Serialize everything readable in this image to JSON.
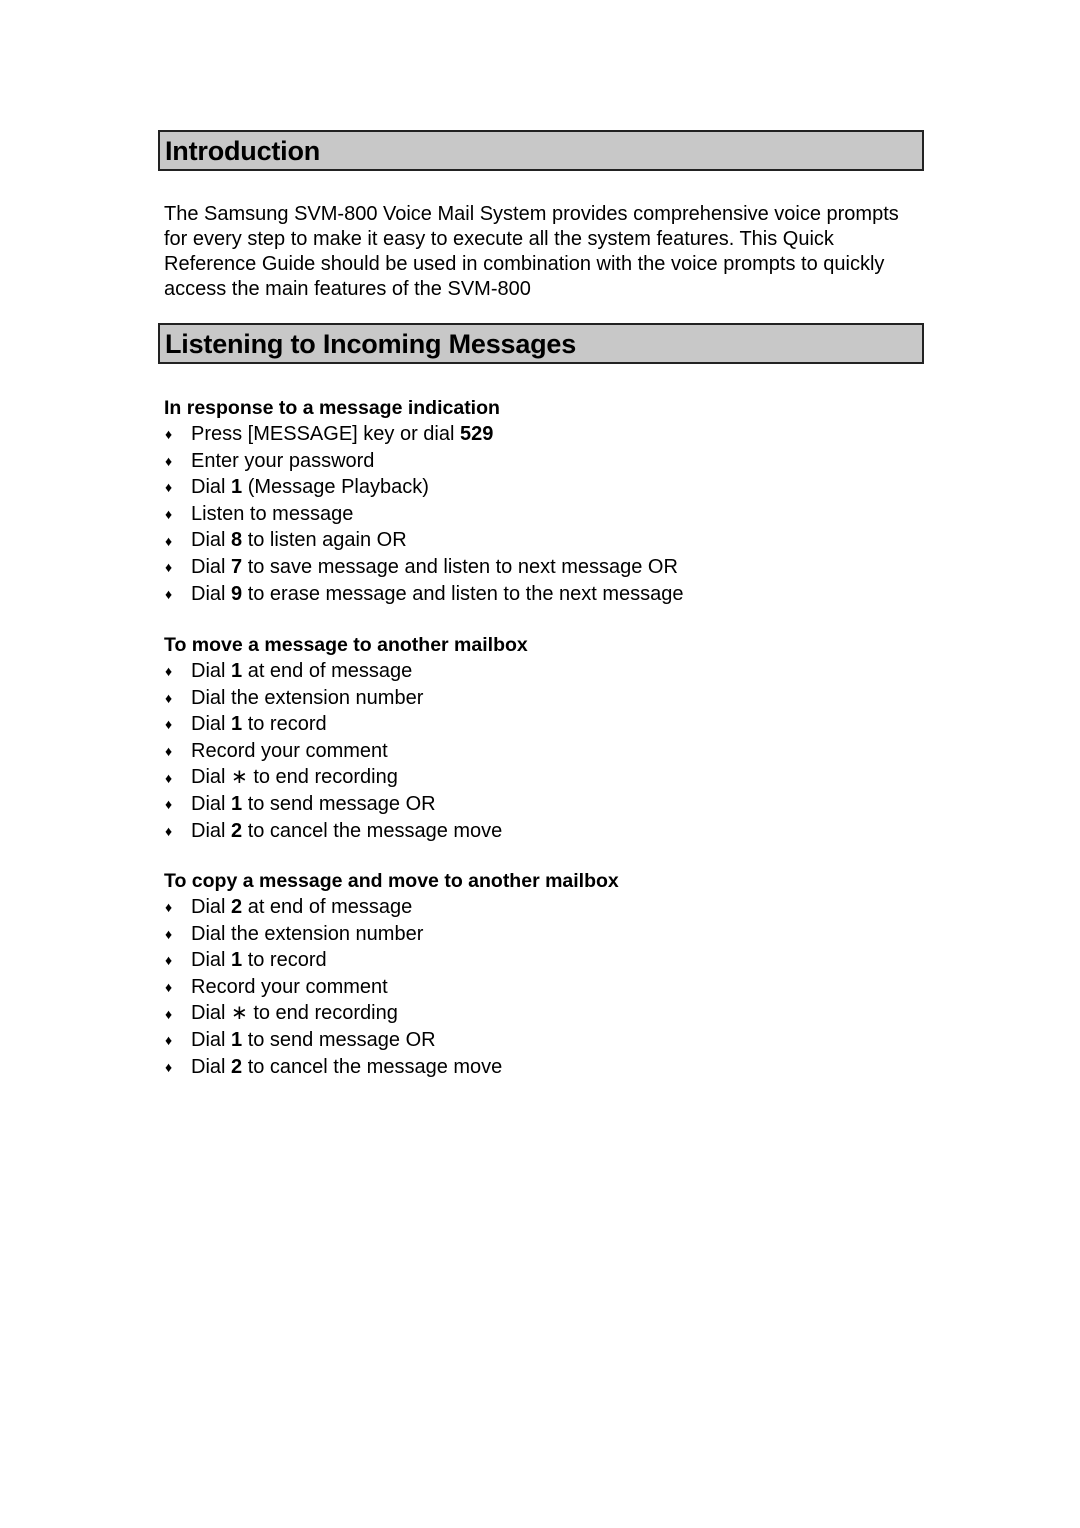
{
  "sections": {
    "introduction": {
      "title": "Introduction",
      "body": "The Samsung SVM-800 Voice Mail System provides comprehensive voice prompts for every step to make it easy to execute all the system features. This Quick Reference Guide should be used in combination with the voice prompts to quickly access the main features of the SVM-800"
    },
    "listening": {
      "title": "Listening to Incoming Messages",
      "blocks": [
        {
          "heading": "In response to a message indication",
          "items": [
            {
              "pre": "Press [MESSAGE] key or dial ",
              "key": "529",
              "post": ""
            },
            {
              "pre": "Enter your password",
              "key": "",
              "post": ""
            },
            {
              "pre": "Dial ",
              "key": "1",
              "post": " (Message Playback)"
            },
            {
              "pre": "Listen to message",
              "key": "",
              "post": ""
            },
            {
              "pre": "Dial ",
              "key": "8",
              "post": " to listen again OR"
            },
            {
              "pre": "Dial ",
              "key": "7",
              "post": " to save message and listen to next message OR"
            },
            {
              "pre": "Dial ",
              "key": "9",
              "post": " to erase message and listen to the next message"
            }
          ]
        },
        {
          "heading": "To move a message to another mailbox",
          "items": [
            {
              "pre": "Dial ",
              "key": "1",
              "post": " at end of message"
            },
            {
              "pre": "Dial the extension number",
              "key": "",
              "post": ""
            },
            {
              "pre": "Dial ",
              "key": "1",
              "post": " to record"
            },
            {
              "pre": "Record your comment",
              "key": "",
              "post": ""
            },
            {
              "pre": "Dial ∗ to end recording",
              "key": "",
              "post": ""
            },
            {
              "pre": "Dial ",
              "key": "1",
              "post": " to send message OR"
            },
            {
              "pre": "Dial ",
              "key": "2",
              "post": " to cancel the message move"
            }
          ]
        },
        {
          "heading": "To copy a message and move to another mailbox",
          "items": [
            {
              "pre": "Dial ",
              "key": "2",
              "post": " at end of message"
            },
            {
              "pre": "Dial the extension number",
              "key": "",
              "post": ""
            },
            {
              "pre": "Dial ",
              "key": "1",
              "post": " to record"
            },
            {
              "pre": "Record your comment",
              "key": "",
              "post": ""
            },
            {
              "pre": "Dial ∗ to end recording",
              "key": "",
              "post": ""
            },
            {
              "pre": "Dial ",
              "key": "1",
              "post": " to send message OR"
            },
            {
              "pre": "Dial ",
              "key": "2",
              "post": " to cancel the message move"
            }
          ]
        }
      ]
    }
  },
  "bullet_glyph": "♦"
}
